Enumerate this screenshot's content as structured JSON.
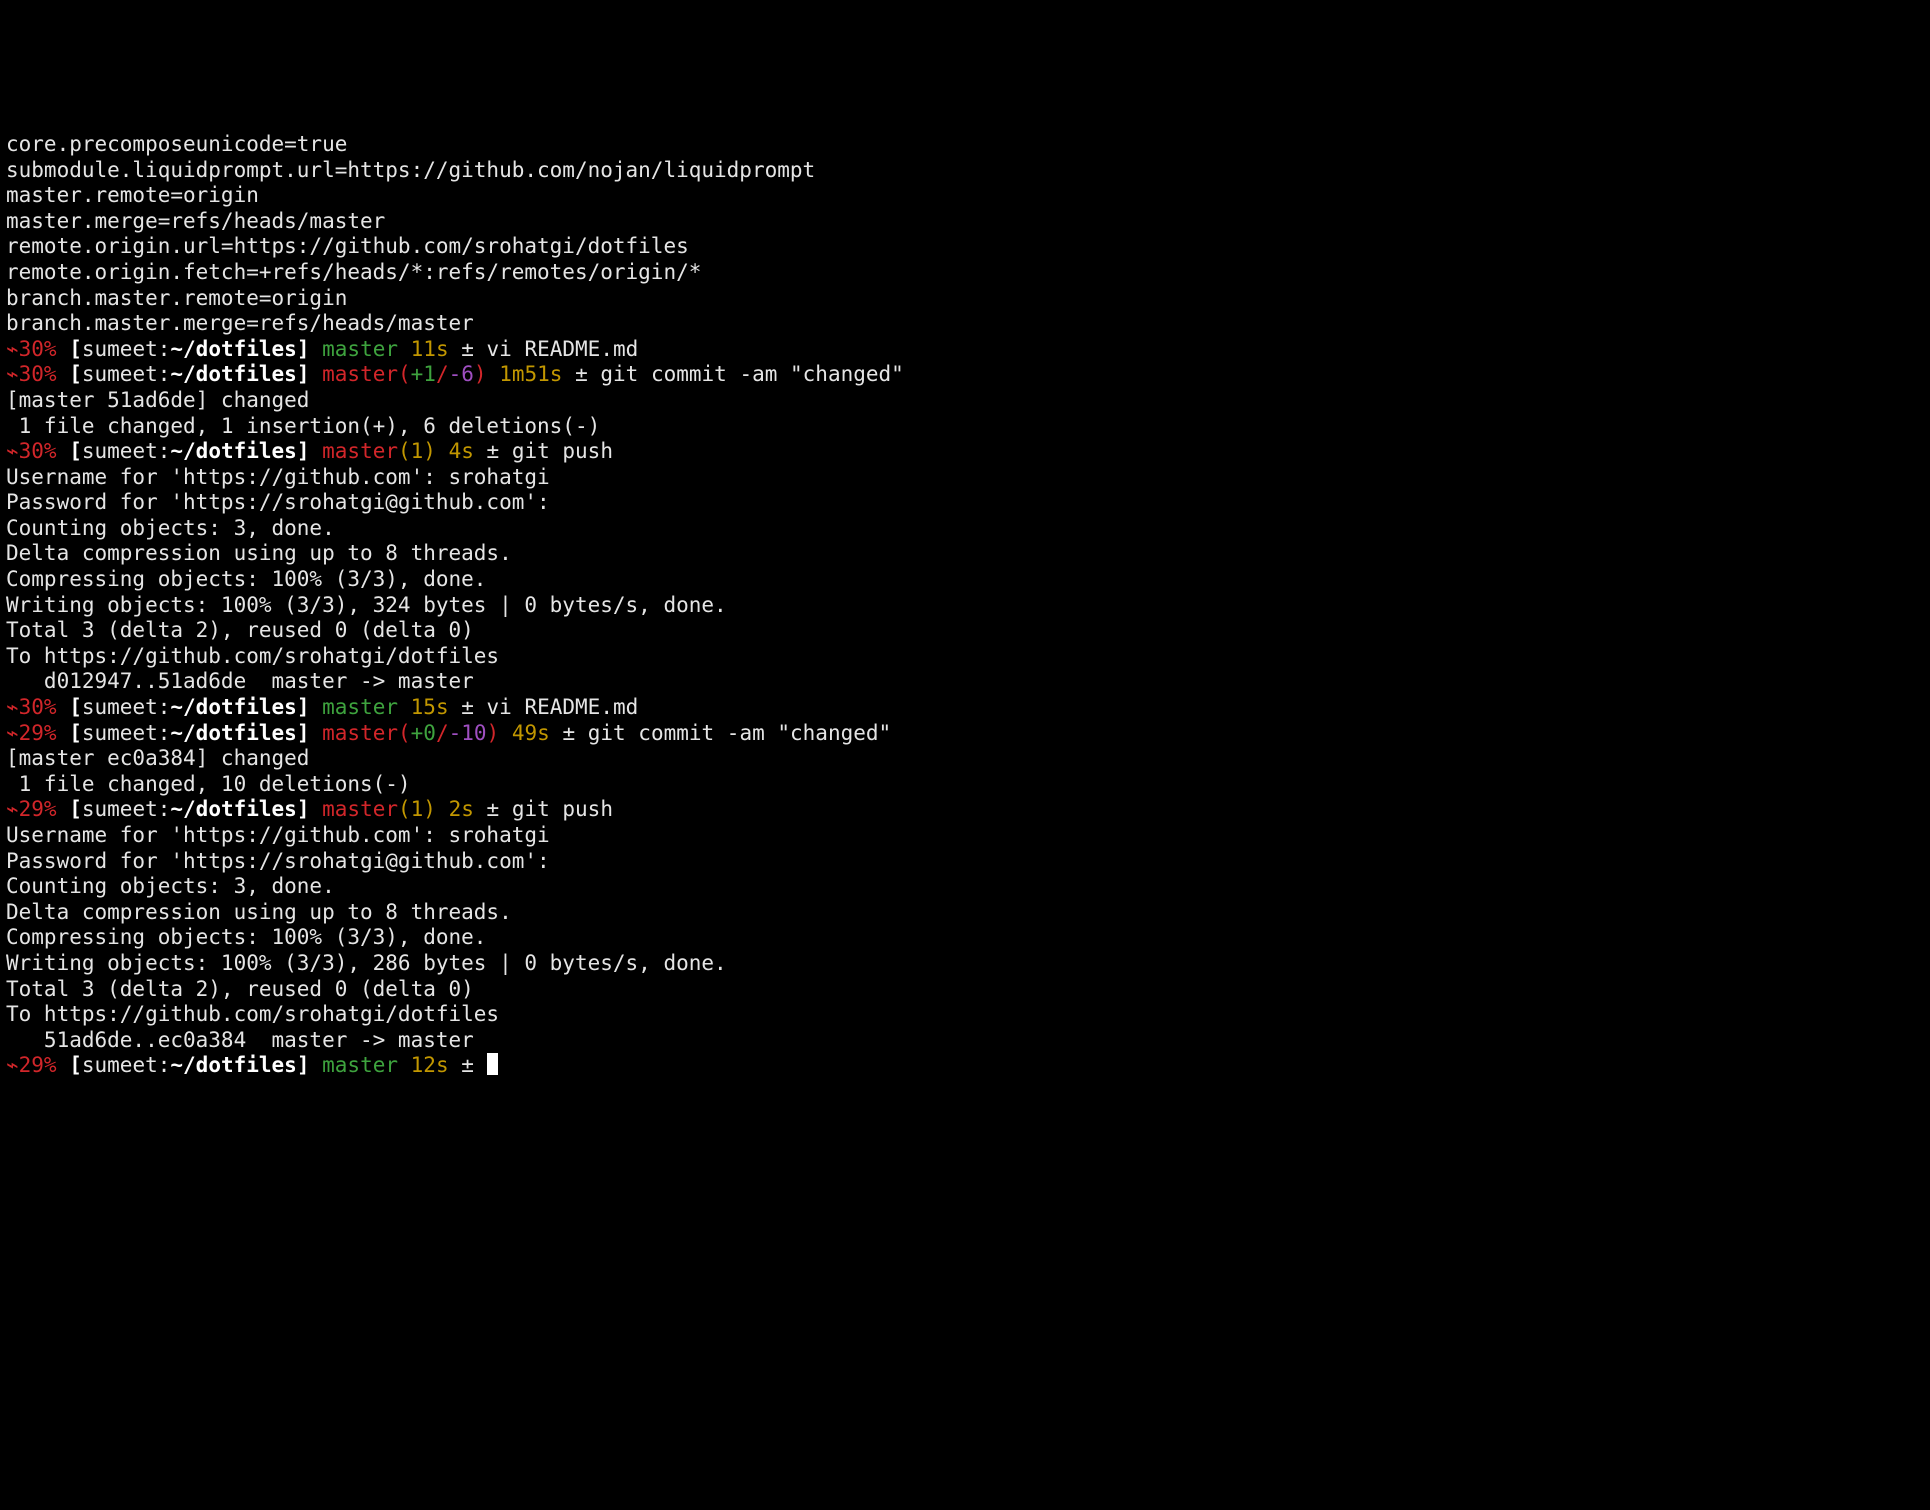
{
  "colors": {
    "bg": "#000000",
    "fg": "#e5e5e5",
    "bold_white": "#ffffff",
    "red": "#d2262a",
    "green": "#3ea33e",
    "yellow": "#c29700",
    "magenta": "#9f4fc1"
  },
  "config_lines": [
    "core.precomposeunicode=true",
    "submodule.liquidprompt.url=https://github.com/nojan/liquidprompt",
    "master.remote=origin",
    "master.merge=refs/heads/master",
    "remote.origin.url=https://github.com/srohatgi/dotfiles",
    "remote.origin.fetch=+refs/heads/*:refs/remotes/origin/*",
    "branch.master.remote=origin",
    "branch.master.merge=refs/heads/master"
  ],
  "prompts": {
    "p1": {
      "battery": "⌁30%",
      "user": "sumeet",
      "path": "~/dotfiles",
      "branch": "master",
      "duration": "11s",
      "tail": " ± ",
      "cmd": "vi README.md"
    },
    "p2": {
      "battery": "⌁30%",
      "user": "sumeet",
      "path": "~/dotfiles",
      "branch": "master",
      "diff_plus": "+1",
      "diff_slash": "/",
      "diff_minus": "-6",
      "duration": "1m51s",
      "tail": " ± ",
      "cmd": "git commit -am \"changed\""
    },
    "p3": {
      "battery": "⌁30%",
      "user": "sumeet",
      "path": "~/dotfiles",
      "branch": "master",
      "ahead": "(1)",
      "duration": "4s",
      "tail": " ± ",
      "cmd": "git push"
    },
    "p4": {
      "battery": "⌁30%",
      "user": "sumeet",
      "path": "~/dotfiles",
      "branch": "master",
      "duration": "15s",
      "tail": " ± ",
      "cmd": "vi README.md"
    },
    "p5": {
      "battery": "⌁29%",
      "user": "sumeet",
      "path": "~/dotfiles",
      "branch": "master",
      "diff_plus": "+0",
      "diff_slash": "/",
      "diff_minus": "-10",
      "duration": "49s",
      "tail": " ± ",
      "cmd": "git commit -am \"changed\""
    },
    "p6": {
      "battery": "⌁29%",
      "user": "sumeet",
      "path": "~/dotfiles",
      "branch": "master",
      "ahead": "(1)",
      "duration": "2s",
      "tail": " ± ",
      "cmd": "git push"
    },
    "p7": {
      "battery": "⌁29%",
      "user": "sumeet",
      "path": "~/dotfiles",
      "branch": "master",
      "duration": "12s",
      "tail": " ± "
    }
  },
  "output": {
    "commit1_l1": "[master 51ad6de] changed",
    "commit1_l2": " 1 file changed, 1 insertion(+), 6 deletions(-)",
    "push1": [
      "Username for 'https://github.com': srohatgi",
      "Password for 'https://srohatgi@github.com':",
      "Counting objects: 3, done.",
      "Delta compression using up to 8 threads.",
      "Compressing objects: 100% (3/3), done.",
      "Writing objects: 100% (3/3), 324 bytes | 0 bytes/s, done.",
      "Total 3 (delta 2), reused 0 (delta 0)",
      "To https://github.com/srohatgi/dotfiles",
      "   d012947..51ad6de  master -> master"
    ],
    "commit2_l1": "[master ec0a384] changed",
    "commit2_l2": " 1 file changed, 10 deletions(-)",
    "push2": [
      "Username for 'https://github.com': srohatgi",
      "Password for 'https://srohatgi@github.com':",
      "Counting objects: 3, done.",
      "Delta compression using up to 8 threads.",
      "Compressing objects: 100% (3/3), done.",
      "Writing objects: 100% (3/3), 286 bytes | 0 bytes/s, done.",
      "Total 3 (delta 2), reused 0 (delta 0)",
      "To https://github.com/srohatgi/dotfiles",
      "   51ad6de..ec0a384  master -> master"
    ]
  }
}
